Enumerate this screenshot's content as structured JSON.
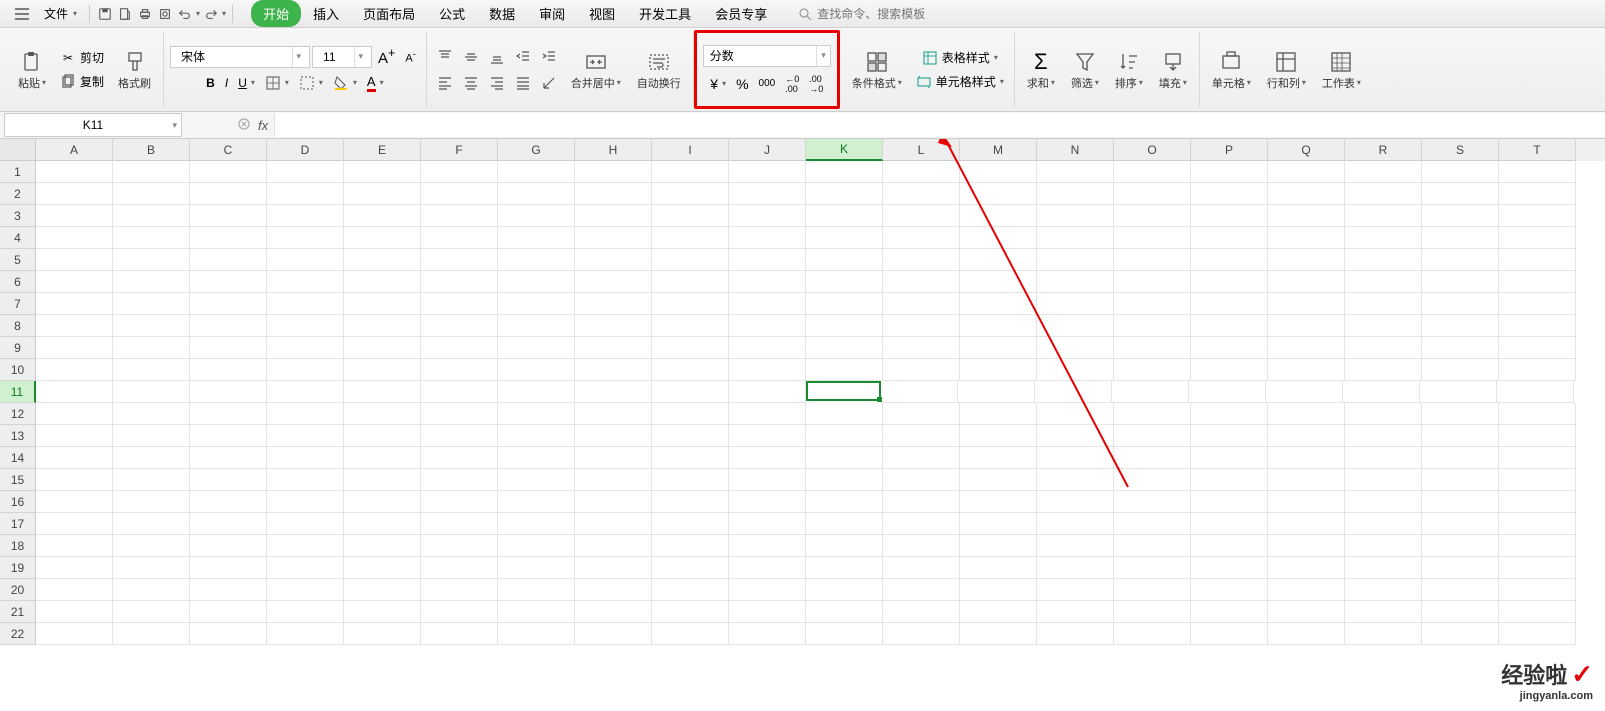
{
  "menu": {
    "file_label": "文件",
    "tabs": [
      "开始",
      "插入",
      "页面布局",
      "公式",
      "数据",
      "审阅",
      "视图",
      "开发工具",
      "会员专享"
    ],
    "active_tab_index": 0,
    "search_placeholder": "查找命令、搜索模板"
  },
  "ribbon": {
    "paste": "粘贴",
    "cut": "剪切",
    "copy": "复制",
    "format_painter": "格式刷",
    "font_name": "宋体",
    "font_size": "11",
    "merge_center": "合并居中",
    "wrap_text": "自动换行",
    "number_format": "分数",
    "conditional_format": "条件格式",
    "table_style": "表格样式",
    "cell_style": "单元格样式",
    "sum": "求和",
    "filter": "筛选",
    "sort": "排序",
    "fill": "填充",
    "cell": "单元格",
    "rowcol": "行和列",
    "worksheet": "工作表"
  },
  "name_box": "K11",
  "columns": [
    "A",
    "B",
    "C",
    "D",
    "E",
    "F",
    "G",
    "H",
    "I",
    "J",
    "K",
    "L",
    "M",
    "N",
    "O",
    "P",
    "Q",
    "R",
    "S",
    "T"
  ],
  "active_col": "K",
  "row_count": 22,
  "active_row": 11,
  "watermark": {
    "main": "经验啦",
    "sub": "jingyanla.com"
  }
}
